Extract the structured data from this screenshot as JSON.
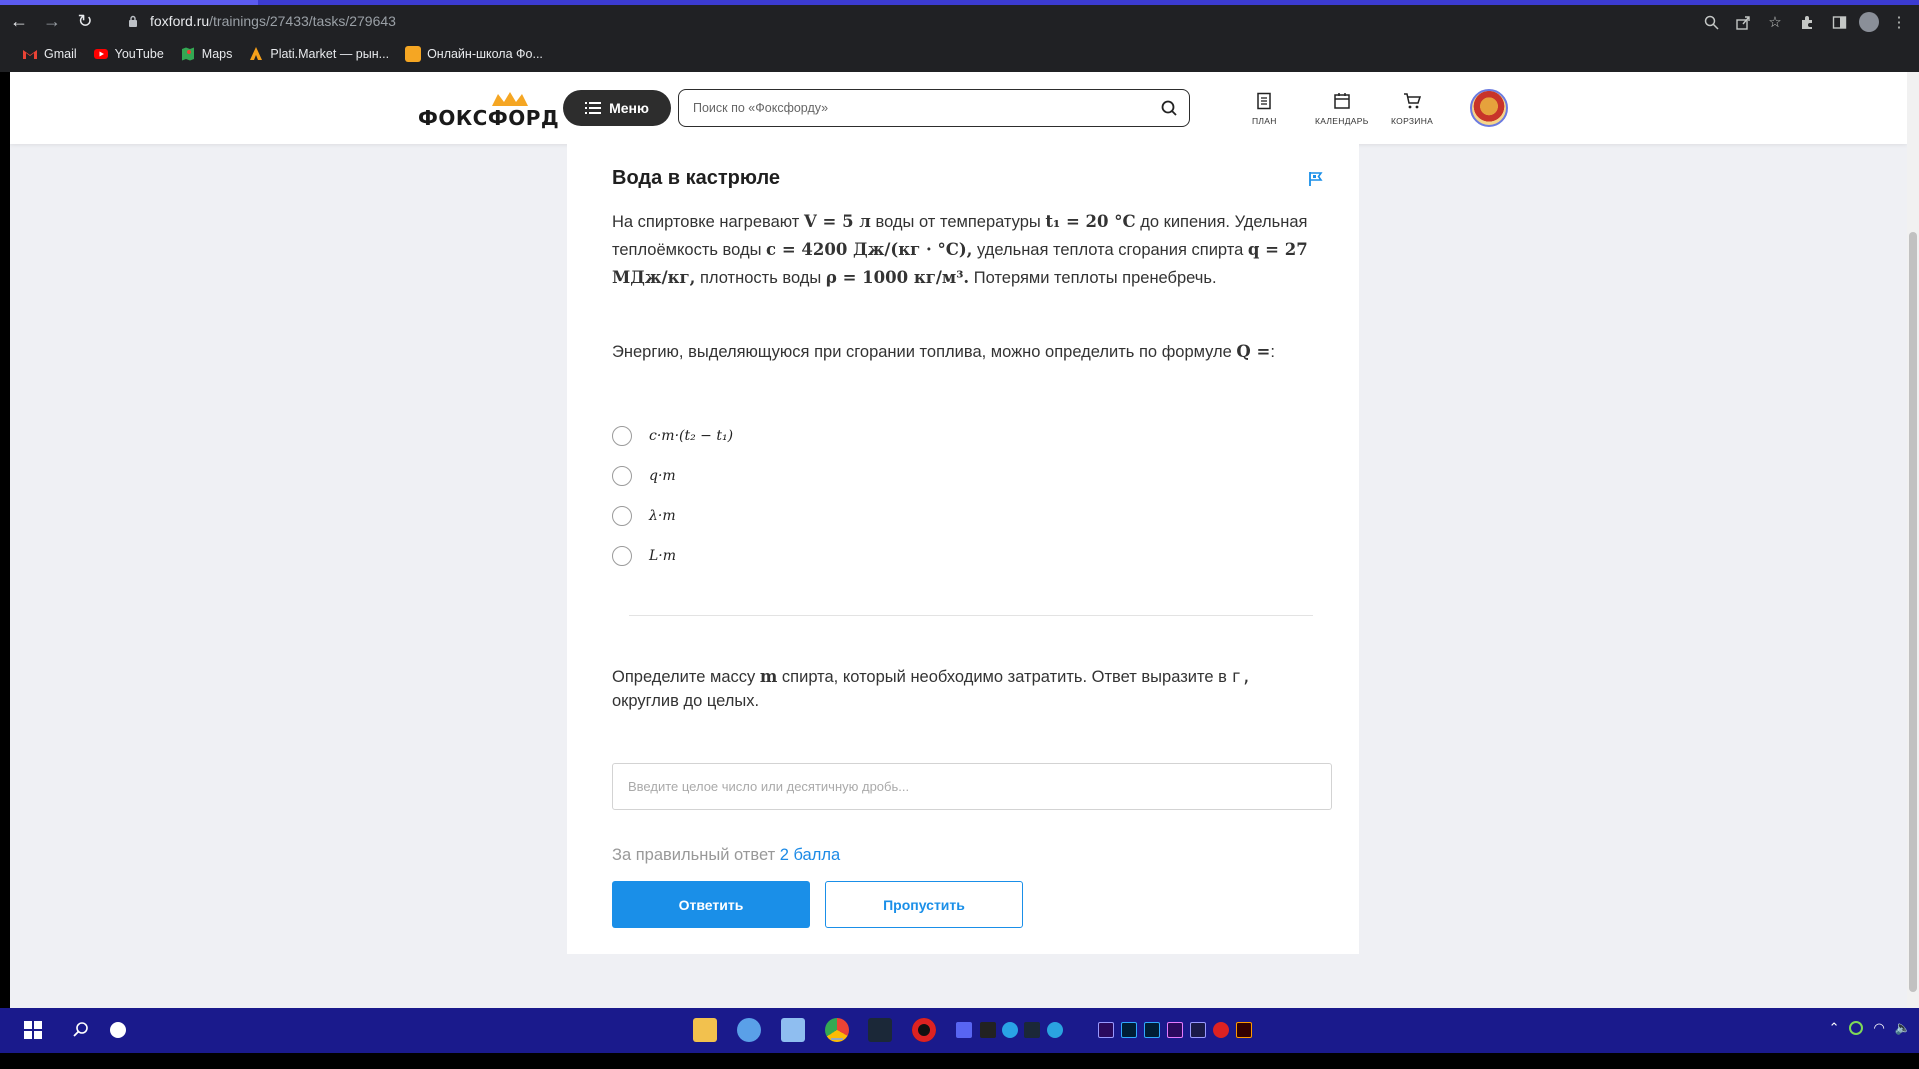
{
  "browser": {
    "url_host": "foxford.ru",
    "url_path": "/trainings/27433/tasks/279643",
    "bookmarks": [
      {
        "label": "Gmail",
        "icon": "gmail-icon",
        "color": "#ea4335"
      },
      {
        "label": "YouTube",
        "icon": "youtube-icon",
        "color": "#ff0000"
      },
      {
        "label": "Maps",
        "icon": "maps-icon",
        "color": "#34a853"
      },
      {
        "label": "Plati.Market — рын...",
        "icon": "plati-icon",
        "color": "#f6a01a"
      },
      {
        "label": "Онлайн-школа Фо...",
        "icon": "foxford-icon",
        "color": "#f5a623"
      }
    ]
  },
  "header": {
    "logo_text": "ФОКСФОРД",
    "menu_label": "Меню",
    "search_placeholder": "Поиск по «Фоксфорду»",
    "nav": {
      "plan": "ПЛАН",
      "calendar": "КАЛЕНДАРЬ",
      "cart": "КОРЗИНА"
    }
  },
  "task": {
    "title": "Вода в кастрюле",
    "problem": {
      "t1": "На спиртовке нагревают ",
      "m1": "V = 5 л",
      "t2": " воды от температуры ",
      "m2": "t₁ = 20 °C",
      "t3": " до кипения. Удельная теплоёмкость воды ",
      "m3": "c = 4200 Дж/(кг · °C),",
      "t4": " удельная теплота сгорания спирта ",
      "m4": "q = 27 МДж/кг,",
      "t5": " плотность воды ",
      "m5": "ρ = 1000 кг/м³.",
      "t6": " Потерями теплоты пренебречь."
    },
    "question1_text": "Энергию, выделяющуюся при сгорании топлива, можно определить по формуле ",
    "question1_math": "Q =",
    "question1_tail": ":",
    "options": [
      "c·m·(t₂ − t₁)",
      "q·m",
      "λ·m",
      "L·m"
    ],
    "question2_a": "Определите массу ",
    "question2_m": "m",
    "question2_b": " спирта, который необходимо затратить. Ответ выразите в ",
    "question2_unit": "г,",
    "question2_c": " округлив до целых.",
    "answer_placeholder": "Введите целое число или десятичную дробь...",
    "points_prefix": "За правильный ответ ",
    "points_value": "2 балла",
    "submit_label": "Ответить",
    "skip_label": "Пропустить"
  },
  "colors": {
    "accent": "#1a8fe8",
    "taskbar": "#1a1a8c",
    "header_dark": "#2d2d2d"
  }
}
